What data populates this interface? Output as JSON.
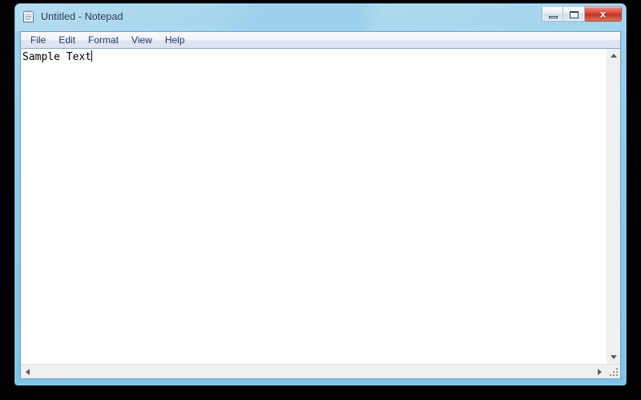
{
  "window": {
    "title": "Untitled - Notepad",
    "app_icon": "notepad-document-icon",
    "titlebar_color": "#8ccaea",
    "frame_border_color": "#5a9fc4",
    "desktop_background": "#000000"
  },
  "window_controls": {
    "minimize": {
      "label": "",
      "icon": "minimize-icon",
      "tooltip": "Minimize"
    },
    "maximize": {
      "label": "",
      "icon": "maximize-icon",
      "tooltip": "Maximize"
    },
    "close": {
      "label": "x",
      "icon": "close-icon",
      "tooltip": "Close",
      "color": "#c4321f"
    }
  },
  "menubar": {
    "items": [
      {
        "label": "File"
      },
      {
        "label": "Edit"
      },
      {
        "label": "Format"
      },
      {
        "label": "View"
      },
      {
        "label": "Help"
      }
    ],
    "text_color": "#1f3864"
  },
  "editor": {
    "content": "Sample Text",
    "caret_visible": true,
    "background": "#ffffff",
    "text_color": "#000000",
    "word_wrap": false
  },
  "scrollbars": {
    "vertical": {
      "up_arrow": "scroll-up-icon",
      "down_arrow": "scroll-down-icon",
      "thumb_visible": false,
      "track_color": "#f0f0f0"
    },
    "horizontal": {
      "left_arrow": "scroll-left-icon",
      "right_arrow": "scroll-right-icon",
      "thumb_visible": false,
      "track_color": "#f0f0f0"
    },
    "resize_grip": "resize-grip-icon"
  }
}
